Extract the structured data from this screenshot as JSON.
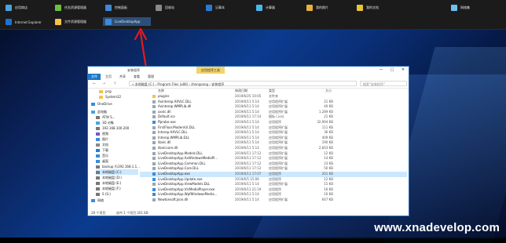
{
  "start_menu": {
    "row1": [
      "应用商店",
      "任务资源管理器",
      "控制面板",
      "回收站",
      "记事本",
      "计算器",
      "我的照片",
      "我的文档",
      "网络集"
    ],
    "row2": [
      "Internet Explorer",
      "文件资源管理器",
      "LiveDesktopApp"
    ]
  },
  "colors": {
    "tile_icons": [
      "#4aa3df",
      "#6cbf3c",
      "#3f88d9",
      "#8a8a8a",
      "#2a7ad5",
      "#4bb7e8",
      "#e8b23a",
      "#e8c43a",
      "#6ec0f0",
      "#1a74d4",
      "#f2c34a",
      "#3a8bdc"
    ],
    "arrow": "#e21b1b",
    "highlight": "#2b4f7b"
  },
  "window": {
    "title": "安装程序",
    "context_tab": "应用程序工具",
    "ribbon_tabs": [
      "文件",
      "主页",
      "共享",
      "查看",
      "管理"
    ],
    "controls": [
      "—",
      "□",
      "✕"
    ],
    "nav": [
      "←",
      "→",
      "↑"
    ],
    "path": "« 本地磁盘 (C:) › Program Files (x86) › zhengsong › 安装程序",
    "search_placeholder": "搜索\"安装程序\"",
    "sidebar": [
      "png",
      "System32",
      "OneDrive",
      "此电脑",
      "ATW S...",
      "3D 对象",
      "192.168.100.200",
      "视频",
      "图片",
      "文档",
      "下载",
      "音乐",
      "桌面",
      "backup (\\\\192.168.1.1...",
      "本地磁盘 (C:)",
      "本地磁盘 (D:)",
      "本地磁盘 (E:)",
      "本地磁盘 (F:)",
      "S (S:)",
      "网络"
    ],
    "columns": [
      "名称",
      "修改日期",
      "类型",
      "大小"
    ],
    "files": [
      {
        "name": "plugins",
        "date": "2019/6/25 10:05",
        "type": "文件夹",
        "size": ""
      },
      {
        "name": "Axinterop.AXVLC.DLL",
        "date": "2019/6/11 5:14",
        "type": "应用程序扩展",
        "size": "21 KB"
      },
      {
        "name": "Axinterop.WMPLib.dll",
        "date": "2019/6/11 5:14",
        "type": "应用程序扩展",
        "size": "40 KB"
      },
      {
        "name": "axvlc.dll",
        "date": "2019/6/11 5:14",
        "type": "应用程序扩展",
        "size": "1,289 KB"
      },
      {
        "name": "Default.ico",
        "date": "2019/6/11 17:14",
        "type": "图标 (.ico)",
        "size": "21 KB"
      },
      {
        "name": "ffprobe.exe",
        "date": "2019/6/11 5:14",
        "type": "应用程序",
        "size": "32,994 KB"
      },
      {
        "name": "FirstFloor.ModernUI.DLL",
        "date": "2019/6/11 5:14",
        "type": "应用程序扩展",
        "size": "111 KB"
      },
      {
        "name": "Interop.AXVLC.DLL",
        "date": "2019/6/11 5:14",
        "type": "应用程序扩展",
        "size": "36 KB"
      },
      {
        "name": "Interop.WMPLib.DLL",
        "date": "2019/6/11 5:14",
        "type": "应用程序扩展",
        "size": "409 KB"
      },
      {
        "name": "libvlc.dll",
        "date": "2019/6/11 5:14",
        "type": "应用程序扩展",
        "size": "190 KB"
      },
      {
        "name": "libvlccore.dll",
        "date": "2019/6/11 5:14",
        "type": "应用程序扩展",
        "size": "2,603 KB"
      },
      {
        "name": "LiveDesktopApp.Models.DLL",
        "date": "2019/6/11 17:12",
        "type": "应用程序扩展",
        "size": "12 KB"
      },
      {
        "name": "LiveDesktopApp.AxWindowsMediaPl...",
        "date": "2019/6/11 17:12",
        "type": "应用程序扩展",
        "size": "14 KB"
      },
      {
        "name": "LiveDesktopApp.Common.DLL",
        "date": "2019/6/11 17:12",
        "type": "应用程序扩展",
        "size": "23 KB"
      },
      {
        "name": "LiveDesktopApp.Core.DLL",
        "date": "2019/6/11 17:12",
        "type": "应用程序扩展",
        "size": "50 KB"
      },
      {
        "name": "LiveDesktopApp.exe",
        "date": "2019/6/11 17:07",
        "type": "应用程序",
        "size": "201 KB"
      },
      {
        "name": "LiveDesktopApp.Update.exe",
        "date": "2019/6/5 15:06",
        "type": "应用程序",
        "size": "12 KB"
      },
      {
        "name": "LiveDesktopApp.ViewModels.DLL",
        "date": "2019/6/11 5:14",
        "type": "应用程序扩展",
        "size": "15 KB"
      },
      {
        "name": "LiveDesktopApp.VlcMediaPlayer.exe",
        "date": "2019/6/11 21:19",
        "type": "应用程序",
        "size": "16 KB"
      },
      {
        "name": "LiveDesktopApp.WpfWindowsMedia...",
        "date": "2019/6/11 5:14",
        "type": "应用程序",
        "size": "16 KB"
      },
      {
        "name": "Newtonsoft.Json.dll",
        "date": "2019/6/11 5:14",
        "type": "应用程序扩展",
        "size": "647 KB"
      }
    ],
    "status_count": "28 个项目",
    "status_selected": "选中 1 个项目 201 KB"
  },
  "watermark": "www.xnadevelop.com"
}
